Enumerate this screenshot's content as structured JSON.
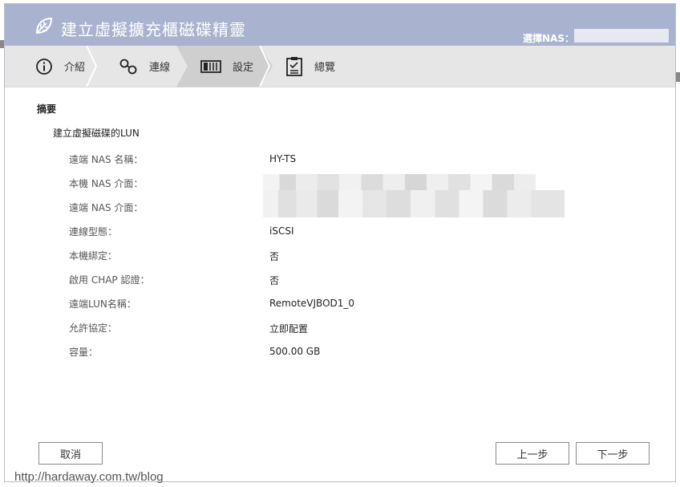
{
  "window": {
    "title": "建立虛擬擴充櫃磁碟精靈",
    "nas_label": "選擇NAS：",
    "nas_selected": ""
  },
  "steps": [
    {
      "label": "介紹",
      "icon": "info-icon"
    },
    {
      "label": "連線",
      "icon": "link-icon"
    },
    {
      "label": "設定",
      "icon": "storage-icon"
    },
    {
      "label": "總覽",
      "icon": "checklist-icon"
    }
  ],
  "summary": {
    "title": "摘要",
    "subtitle": "建立虛擬磁碟的LUN",
    "rows": [
      {
        "label": "遠端 NAS 名稱：",
        "value": "HY-TS"
      },
      {
        "label": "本機 NAS 介面：",
        "value": ""
      },
      {
        "label": "遠端 NAS 介面：",
        "value": ""
      },
      {
        "label": "連線型態：",
        "value": "iSCSI"
      },
      {
        "label": "本機綁定：",
        "value": "否"
      },
      {
        "label": "啟用 CHAP 認證：",
        "value": "否"
      },
      {
        "label": "遠端LUN名稱：",
        "value": "RemoteVJBOD1_0"
      },
      {
        "label": "允許協定：",
        "value": "立即配置"
      },
      {
        "label": "容量：",
        "value": "500.00 GB"
      }
    ]
  },
  "buttons": {
    "cancel": "取消",
    "prev": "上一步",
    "next": "下一步"
  },
  "watermark": "http://hardaway.com.tw/blog",
  "colors": {
    "header_bg": "#a9b3cf",
    "stepbar_bg": "#e6e6e6",
    "active_step_bg": "#cfcfcf"
  }
}
